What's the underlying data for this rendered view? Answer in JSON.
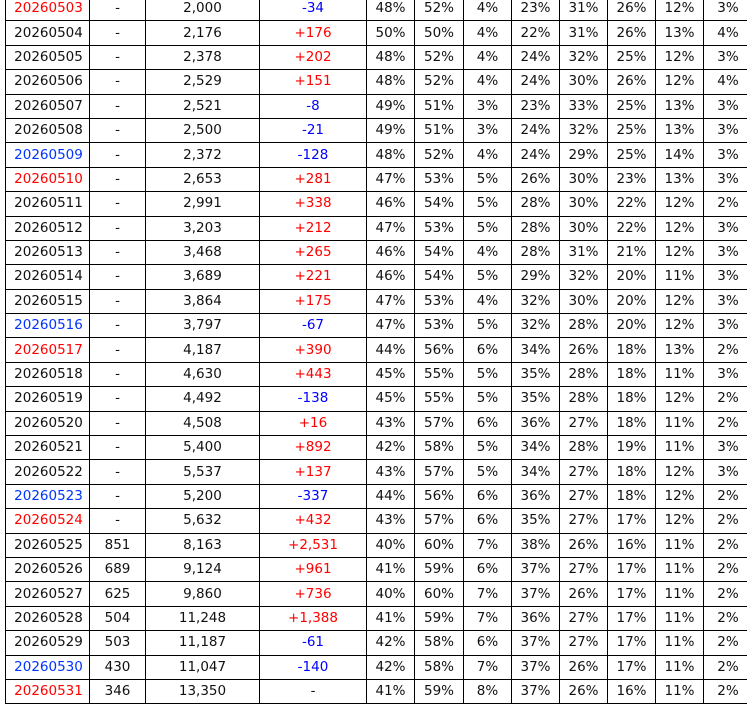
{
  "colors": {
    "text": "#111111",
    "positive_delta": "#ff0000",
    "negative_delta": "#0000ff",
    "saturday_date": "#0033ff",
    "sunday_date": "#ff0000",
    "grid": "#000000"
  },
  "rows": [
    {
      "date": "20260503",
      "day_type": "sun",
      "col2": "-",
      "total": "2,000",
      "delta": "-34",
      "delta_sign": "neg",
      "p1": "48%",
      "p2": "52%",
      "p3": "4%",
      "p4": "23%",
      "p5": "31%",
      "p6": "26%",
      "p7": "12%",
      "p8": "3%"
    },
    {
      "date": "20260504",
      "day_type": "weekday",
      "col2": "-",
      "total": "2,176",
      "delta": "+176",
      "delta_sign": "pos",
      "p1": "50%",
      "p2": "50%",
      "p3": "4%",
      "p4": "22%",
      "p5": "31%",
      "p6": "26%",
      "p7": "13%",
      "p8": "4%"
    },
    {
      "date": "20260505",
      "day_type": "weekday",
      "col2": "-",
      "total": "2,378",
      "delta": "+202",
      "delta_sign": "pos",
      "p1": "48%",
      "p2": "52%",
      "p3": "4%",
      "p4": "24%",
      "p5": "32%",
      "p6": "25%",
      "p7": "12%",
      "p8": "3%"
    },
    {
      "date": "20260506",
      "day_type": "weekday",
      "col2": "-",
      "total": "2,529",
      "delta": "+151",
      "delta_sign": "pos",
      "p1": "48%",
      "p2": "52%",
      "p3": "4%",
      "p4": "24%",
      "p5": "30%",
      "p6": "26%",
      "p7": "12%",
      "p8": "4%"
    },
    {
      "date": "20260507",
      "day_type": "weekday",
      "col2": "-",
      "total": "2,521",
      "delta": "-8",
      "delta_sign": "neg",
      "p1": "49%",
      "p2": "51%",
      "p3": "3%",
      "p4": "23%",
      "p5": "33%",
      "p6": "25%",
      "p7": "13%",
      "p8": "3%"
    },
    {
      "date": "20260508",
      "day_type": "weekday",
      "col2": "-",
      "total": "2,500",
      "delta": "-21",
      "delta_sign": "neg",
      "p1": "49%",
      "p2": "51%",
      "p3": "3%",
      "p4": "24%",
      "p5": "32%",
      "p6": "25%",
      "p7": "13%",
      "p8": "3%"
    },
    {
      "date": "20260509",
      "day_type": "sat",
      "col2": "-",
      "total": "2,372",
      "delta": "-128",
      "delta_sign": "neg",
      "p1": "48%",
      "p2": "52%",
      "p3": "4%",
      "p4": "24%",
      "p5": "29%",
      "p6": "25%",
      "p7": "14%",
      "p8": "3%"
    },
    {
      "date": "20260510",
      "day_type": "sun",
      "col2": "-",
      "total": "2,653",
      "delta": "+281",
      "delta_sign": "pos",
      "p1": "47%",
      "p2": "53%",
      "p3": "5%",
      "p4": "26%",
      "p5": "30%",
      "p6": "23%",
      "p7": "13%",
      "p8": "3%"
    },
    {
      "date": "20260511",
      "day_type": "weekday",
      "col2": "-",
      "total": "2,991",
      "delta": "+338",
      "delta_sign": "pos",
      "p1": "46%",
      "p2": "54%",
      "p3": "5%",
      "p4": "28%",
      "p5": "30%",
      "p6": "22%",
      "p7": "12%",
      "p8": "2%"
    },
    {
      "date": "20260512",
      "day_type": "weekday",
      "col2": "-",
      "total": "3,203",
      "delta": "+212",
      "delta_sign": "pos",
      "p1": "47%",
      "p2": "53%",
      "p3": "5%",
      "p4": "28%",
      "p5": "30%",
      "p6": "22%",
      "p7": "12%",
      "p8": "3%"
    },
    {
      "date": "20260513",
      "day_type": "weekday",
      "col2": "-",
      "total": "3,468",
      "delta": "+265",
      "delta_sign": "pos",
      "p1": "46%",
      "p2": "54%",
      "p3": "4%",
      "p4": "28%",
      "p5": "31%",
      "p6": "21%",
      "p7": "12%",
      "p8": "3%"
    },
    {
      "date": "20260514",
      "day_type": "weekday",
      "col2": "-",
      "total": "3,689",
      "delta": "+221",
      "delta_sign": "pos",
      "p1": "46%",
      "p2": "54%",
      "p3": "5%",
      "p4": "29%",
      "p5": "32%",
      "p6": "20%",
      "p7": "11%",
      "p8": "3%"
    },
    {
      "date": "20260515",
      "day_type": "weekday",
      "col2": "-",
      "total": "3,864",
      "delta": "+175",
      "delta_sign": "pos",
      "p1": "47%",
      "p2": "53%",
      "p3": "4%",
      "p4": "32%",
      "p5": "30%",
      "p6": "20%",
      "p7": "12%",
      "p8": "3%"
    },
    {
      "date": "20260516",
      "day_type": "sat",
      "col2": "-",
      "total": "3,797",
      "delta": "-67",
      "delta_sign": "neg",
      "p1": "47%",
      "p2": "53%",
      "p3": "5%",
      "p4": "32%",
      "p5": "28%",
      "p6": "20%",
      "p7": "12%",
      "p8": "3%"
    },
    {
      "date": "20260517",
      "day_type": "sun",
      "col2": "-",
      "total": "4,187",
      "delta": "+390",
      "delta_sign": "pos",
      "p1": "44%",
      "p2": "56%",
      "p3": "6%",
      "p4": "34%",
      "p5": "26%",
      "p6": "18%",
      "p7": "13%",
      "p8": "2%"
    },
    {
      "date": "20260518",
      "day_type": "weekday",
      "col2": "-",
      "total": "4,630",
      "delta": "+443",
      "delta_sign": "pos",
      "p1": "45%",
      "p2": "55%",
      "p3": "5%",
      "p4": "35%",
      "p5": "28%",
      "p6": "18%",
      "p7": "11%",
      "p8": "3%"
    },
    {
      "date": "20260519",
      "day_type": "weekday",
      "col2": "-",
      "total": "4,492",
      "delta": "-138",
      "delta_sign": "neg",
      "p1": "45%",
      "p2": "55%",
      "p3": "5%",
      "p4": "35%",
      "p5": "28%",
      "p6": "18%",
      "p7": "12%",
      "p8": "2%"
    },
    {
      "date": "20260520",
      "day_type": "weekday",
      "col2": "-",
      "total": "4,508",
      "delta": "+16",
      "delta_sign": "pos",
      "p1": "43%",
      "p2": "57%",
      "p3": "6%",
      "p4": "36%",
      "p5": "27%",
      "p6": "18%",
      "p7": "11%",
      "p8": "2%"
    },
    {
      "date": "20260521",
      "day_type": "weekday",
      "col2": "-",
      "total": "5,400",
      "delta": "+892",
      "delta_sign": "pos",
      "p1": "42%",
      "p2": "58%",
      "p3": "5%",
      "p4": "34%",
      "p5": "28%",
      "p6": "19%",
      "p7": "11%",
      "p8": "3%"
    },
    {
      "date": "20260522",
      "day_type": "weekday",
      "col2": "-",
      "total": "5,537",
      "delta": "+137",
      "delta_sign": "pos",
      "p1": "43%",
      "p2": "57%",
      "p3": "5%",
      "p4": "34%",
      "p5": "27%",
      "p6": "18%",
      "p7": "12%",
      "p8": "3%"
    },
    {
      "date": "20260523",
      "day_type": "sat",
      "col2": "-",
      "total": "5,200",
      "delta": "-337",
      "delta_sign": "neg",
      "p1": "44%",
      "p2": "56%",
      "p3": "6%",
      "p4": "36%",
      "p5": "27%",
      "p6": "18%",
      "p7": "12%",
      "p8": "2%"
    },
    {
      "date": "20260524",
      "day_type": "sun",
      "col2": "-",
      "total": "5,632",
      "delta": "+432",
      "delta_sign": "pos",
      "p1": "43%",
      "p2": "57%",
      "p3": "6%",
      "p4": "35%",
      "p5": "27%",
      "p6": "17%",
      "p7": "12%",
      "p8": "2%"
    },
    {
      "date": "20260525",
      "day_type": "weekday",
      "col2": "851",
      "total": "8,163",
      "delta": "+2,531",
      "delta_sign": "pos",
      "p1": "40%",
      "p2": "60%",
      "p3": "7%",
      "p4": "38%",
      "p5": "26%",
      "p6": "16%",
      "p7": "11%",
      "p8": "2%"
    },
    {
      "date": "20260526",
      "day_type": "weekday",
      "col2": "689",
      "total": "9,124",
      "delta": "+961",
      "delta_sign": "pos",
      "p1": "41%",
      "p2": "59%",
      "p3": "6%",
      "p4": "37%",
      "p5": "27%",
      "p6": "17%",
      "p7": "11%",
      "p8": "2%"
    },
    {
      "date": "20260527",
      "day_type": "weekday",
      "col2": "625",
      "total": "9,860",
      "delta": "+736",
      "delta_sign": "pos",
      "p1": "40%",
      "p2": "60%",
      "p3": "7%",
      "p4": "37%",
      "p5": "26%",
      "p6": "17%",
      "p7": "11%",
      "p8": "2%"
    },
    {
      "date": "20260528",
      "day_type": "weekday",
      "col2": "504",
      "total": "11,248",
      "delta": "+1,388",
      "delta_sign": "pos",
      "p1": "41%",
      "p2": "59%",
      "p3": "7%",
      "p4": "36%",
      "p5": "27%",
      "p6": "17%",
      "p7": "11%",
      "p8": "2%"
    },
    {
      "date": "20260529",
      "day_type": "weekday",
      "col2": "503",
      "total": "11,187",
      "delta": "-61",
      "delta_sign": "neg",
      "p1": "42%",
      "p2": "58%",
      "p3": "6%",
      "p4": "37%",
      "p5": "27%",
      "p6": "17%",
      "p7": "11%",
      "p8": "2%"
    },
    {
      "date": "20260530",
      "day_type": "sat",
      "col2": "430",
      "total": "11,047",
      "delta": "-140",
      "delta_sign": "neg",
      "p1": "42%",
      "p2": "58%",
      "p3": "7%",
      "p4": "37%",
      "p5": "26%",
      "p6": "17%",
      "p7": "11%",
      "p8": "2%"
    },
    {
      "date": "20260531",
      "day_type": "sun",
      "col2": "346",
      "total": "13,350",
      "delta": "-",
      "delta_sign": "none",
      "p1": "41%",
      "p2": "59%",
      "p3": "8%",
      "p4": "37%",
      "p5": "26%",
      "p6": "16%",
      "p7": "11%",
      "p8": "2%"
    }
  ]
}
